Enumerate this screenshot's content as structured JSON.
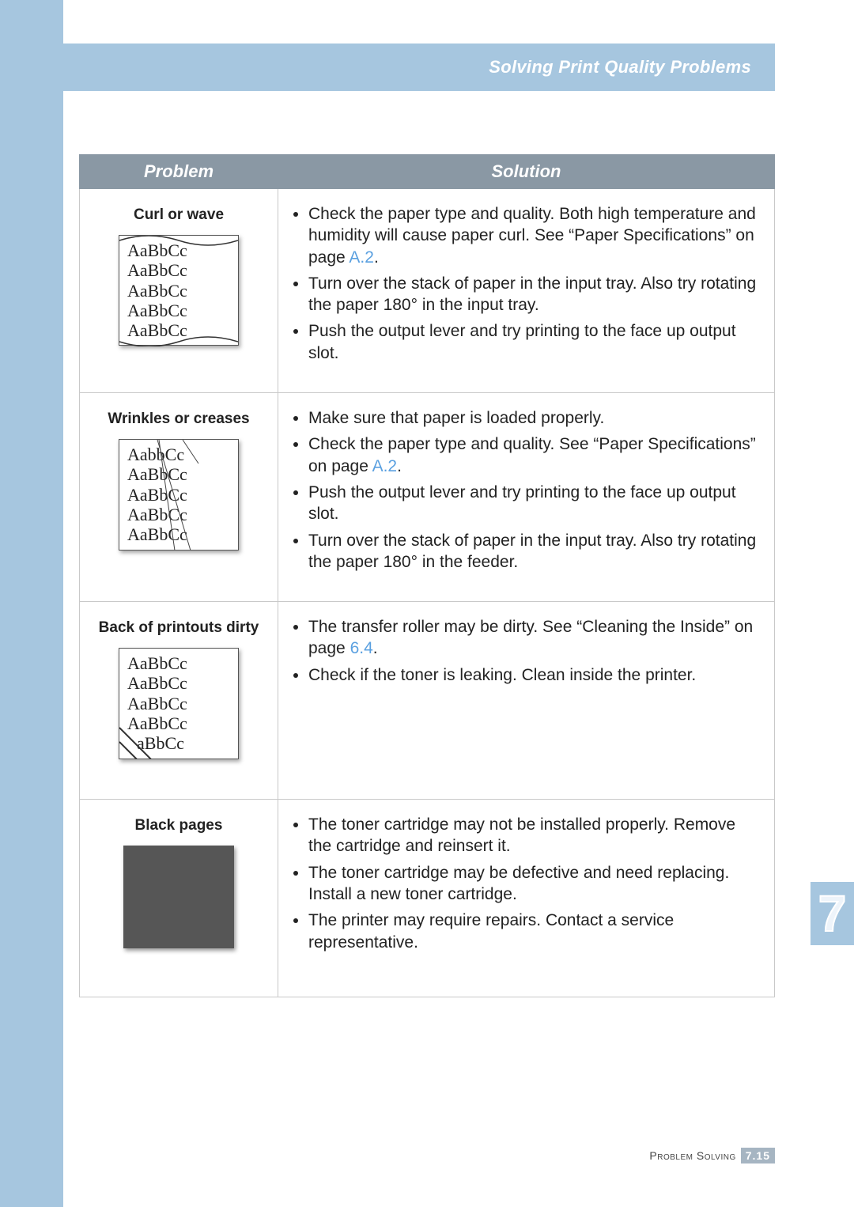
{
  "header": {
    "section_title": "Solving Print Quality Problems"
  },
  "table": {
    "headers": {
      "problem": "Problem",
      "solution": "Solution"
    },
    "rows": [
      {
        "title": "Curl or wave",
        "sample_lines": [
          "AaBbCc",
          "AaBbCc",
          "AaBbCc",
          "AaBbCc",
          "AaBbCc"
        ],
        "solutions": [
          {
            "text_pre": "Check the paper type and quality. Both high temperature and humidity will cause paper curl. See “Paper Specifications” on page ",
            "link": "A.2",
            "text_post": "."
          },
          {
            "text_pre": "Turn over the stack of paper in the input tray. Also try rotating the paper 180° in the input tray.",
            "link": "",
            "text_post": ""
          },
          {
            "text_pre": "Push the output lever and try printing to the face up output slot.",
            "link": "",
            "text_post": ""
          }
        ]
      },
      {
        "title": "Wrinkles or creases",
        "sample_lines": [
          "AabbCc",
          "AaBbCc",
          "AaBbCc",
          "AaBbCc",
          "AaBbCc"
        ],
        "solutions": [
          {
            "text_pre": "Make sure that paper is loaded properly.",
            "link": "",
            "text_post": ""
          },
          {
            "text_pre": "Check the paper type and quality. See “Paper Specifications” on page ",
            "link": "A.2",
            "text_post": "."
          },
          {
            "text_pre": "Push the output lever and try printing to the face up output slot.",
            "link": "",
            "text_post": ""
          },
          {
            "text_pre": "Turn over the stack of paper in the input tray. Also try rotating the paper 180° in the feeder.",
            "link": "",
            "text_post": ""
          }
        ]
      },
      {
        "title": "Back of printouts dirty",
        "sample_lines": [
          "AaBbCc",
          "AaBbCc",
          "AaBbCc",
          "AaBbCc",
          "aBbCc"
        ],
        "solutions": [
          {
            "text_pre": "The transfer roller may be dirty. See “Cleaning the Inside” on page ",
            "link": "6.4",
            "text_post": "."
          },
          {
            "text_pre": "Check if the toner is leaking. Clean inside the printer.",
            "link": "",
            "text_post": ""
          }
        ]
      },
      {
        "title": "Black pages",
        "sample_lines": [],
        "solutions": [
          {
            "text_pre": "The toner cartridge may not be installed properly. Remove the cartridge and reinsert it.",
            "link": "",
            "text_post": ""
          },
          {
            "text_pre": "The toner cartridge may be defective and need replacing. Install a new toner cartridge.",
            "link": "",
            "text_post": ""
          },
          {
            "text_pre": "The printer may require repairs. Contact a service representative.",
            "link": "",
            "text_post": ""
          }
        ]
      }
    ]
  },
  "chapter_tab": {
    "number": "7"
  },
  "footer": {
    "section": "Problem Solving",
    "page_chapter": "7.",
    "page_num": "15"
  },
  "sample_svg_overlays": {
    "curl": "wavy-top-bottom",
    "wrinkle": "diagonal-creases",
    "dirty": "smudge-corner"
  }
}
